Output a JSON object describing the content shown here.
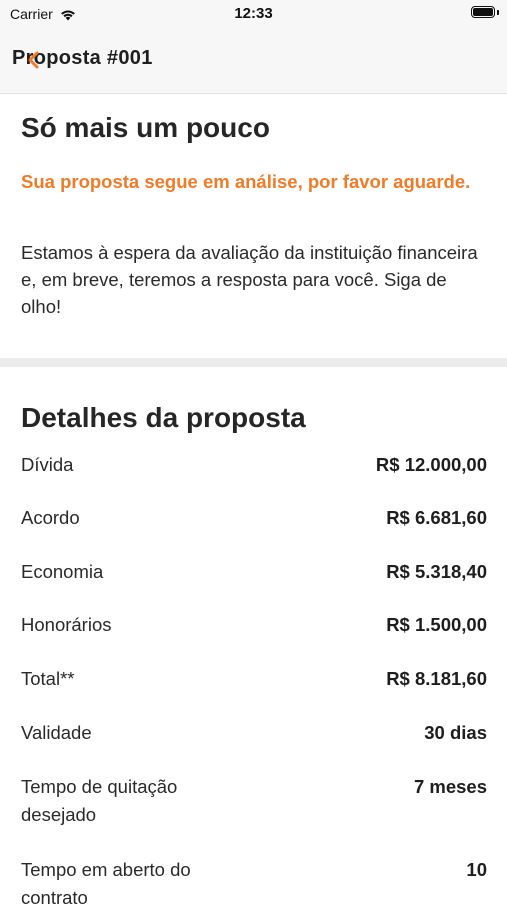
{
  "status_bar": {
    "carrier": "Carrier",
    "time": "12:33"
  },
  "nav": {
    "title": "Proposta #001",
    "back_icon": "chevron-left-icon",
    "accent": "#f07b28"
  },
  "status_section": {
    "heading": "Só mais um pouco",
    "subtitle": "Sua proposta segue em análise, por favor aguarde.",
    "description": "Estamos à espera da avaliação da instituição financeira e, em breve, teremos a resposta para você. Siga de olho!"
  },
  "details": {
    "heading": "Detalhes da proposta",
    "rows": [
      {
        "label": "Dívida",
        "value": "R$ 12.000,00"
      },
      {
        "label": "Acordo",
        "value": "R$ 6.681,60"
      },
      {
        "label": "Economia",
        "value": "R$ 5.318,40"
      },
      {
        "label": "Honorários",
        "value": "R$ 1.500,00"
      },
      {
        "label": "Total**",
        "value": "R$ 8.181,60"
      },
      {
        "label": "Validade",
        "value": "30 dias"
      },
      {
        "label": "Tempo de quitação desejado",
        "value": "7 meses"
      },
      {
        "label": "Tempo em aberto do contrato",
        "value": "10"
      }
    ]
  }
}
